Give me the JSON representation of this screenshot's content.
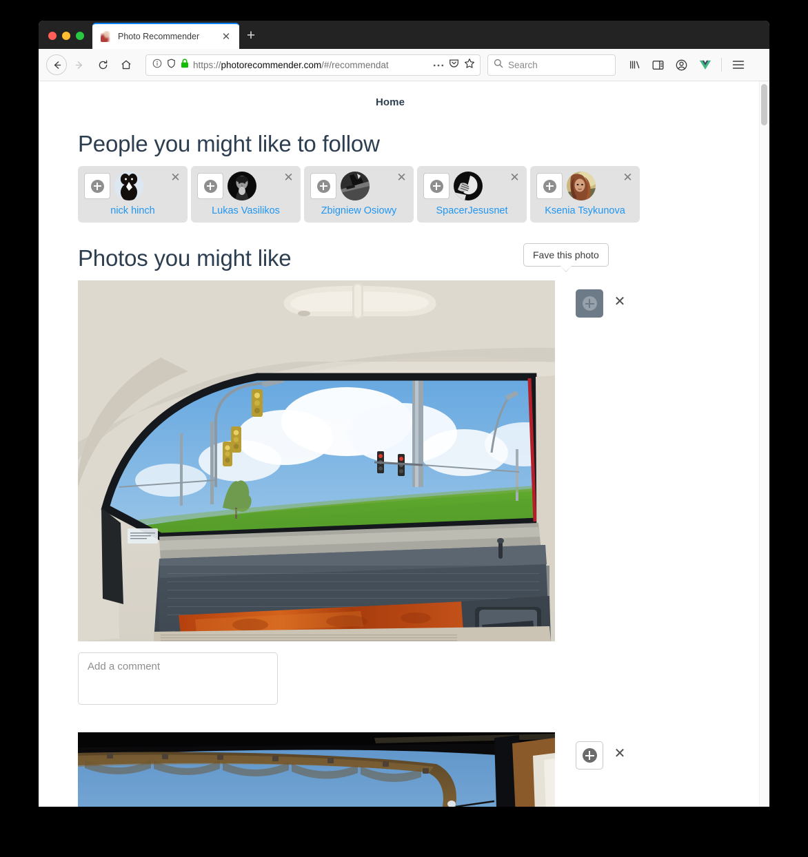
{
  "window": {
    "traffic_lights": [
      "close",
      "minimize",
      "maximize"
    ]
  },
  "tab": {
    "title": "Photo Recommender",
    "close_label": "✕",
    "new_tab_label": "+"
  },
  "toolbar": {
    "back_icon": "back-arrow-icon",
    "forward_icon": "forward-arrow-icon",
    "reload_icon": "reload-icon",
    "home_icon": "home-icon",
    "url_scheme": "https://",
    "url_host": "photorecommender.com",
    "url_path": "/#/recommendat",
    "url_full": "https://photorecommender.com/#/recommendat",
    "info_icon": "page-info-icon",
    "shield_icon": "tracking-protection-shield-icon",
    "lock_icon": "secure-lock-icon",
    "page_actions_icon": "ellipsis-icon",
    "pocket_icon": "pocket-icon",
    "bookmark_icon": "star-icon",
    "search_placeholder": "Search",
    "search_icon": "search-icon",
    "library_icon": "library-icon",
    "sidebar_icon": "sidebar-icon",
    "account_icon": "account-icon",
    "vue_devtools_icon": "vue-devtools-icon",
    "vue_devtools_color": "#41b883",
    "menu_icon": "hamburger-menu-icon"
  },
  "page": {
    "nav": {
      "home_label": "Home"
    },
    "people_section": {
      "title": "People you might like to follow",
      "close_label": "✕",
      "people": [
        {
          "name": "nick hinch",
          "avatar": "penguin-illustration"
        },
        {
          "name": "Lukas Vasilikos",
          "avatar": "bw-portrait-man"
        },
        {
          "name": "Zbigniew Osiowy",
          "avatar": "bw-skateboarder"
        },
        {
          "name": "SpacerJesusnet",
          "avatar": "bw-abstract-shoe"
        },
        {
          "name": "Ksenia Tsykunova",
          "avatar": "woman-red-hair-portrait"
        }
      ]
    },
    "photos_section": {
      "title": "Photos you might like",
      "tooltip_label": "Fave this photo",
      "close_label": "✕",
      "comment_placeholder": "Add a comment",
      "photos": [
        {
          "alt": "View through a car window of a person lying on a grassy hill with traffic lights and clouds",
          "fave_state": "hovered",
          "has_comment_box": true,
          "comment_value": ""
        },
        {
          "alt": "Dark awning structure against a blue sky with clouds",
          "fave_state": "normal",
          "has_comment_box": false,
          "comment_value": ""
        }
      ]
    }
  },
  "colors": {
    "heading": "#2c3e50",
    "link": "#2196f3",
    "card_bg": "#e2e2e2",
    "tab_accent": "#0a84ff",
    "active_button": "#6d7a87"
  }
}
